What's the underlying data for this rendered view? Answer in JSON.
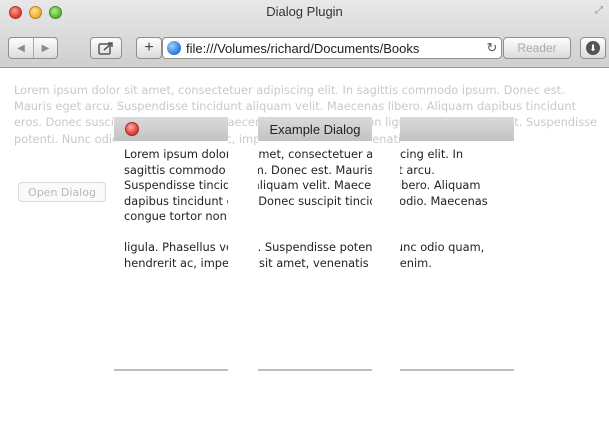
{
  "window": {
    "title": "Dialog Plugin",
    "url": "file:///Volumes/richard/Documents/Books",
    "reader_label": "Reader"
  },
  "page": {
    "lorem": "Lorem ipsum dolor sit amet, consectetuer adipiscing elit. In sagittis commodo ipsum. Donec est. Mauris eget arcu. Suspendisse tincidunt aliquam velit. Maecenas libero. Aliquam dapibus tincidunt eros. Donec suscipit tincidunt odio. Maecenas congue tortor non ligula. Phasellus vel elit. Suspendisse potenti. Nunc odio quam, hendrerit ac, imperdiet sit amet, venenatis sed, enim.",
    "open_button": "Open Dialog"
  },
  "dialog": {
    "title": "Example Dialog",
    "para1": "Lorem ipsum dolor sit amet, consectetuer adipiscing elit. In sagittis commodo ipsum. Donec est. Mauris eget arcu. Suspendisse tincidunt aliquam velit. Maecenas libero. Aliquam dapibus tincidunt eros. Donec suscipit tincidunt odio. Maecenas congue tortor non",
    "para2": "ligula. Phasellus vel elit. Suspendisse potenti. Nunc odio quam, hendrerit ac, imperdiet sit amet, venenatis sed, enim."
  }
}
